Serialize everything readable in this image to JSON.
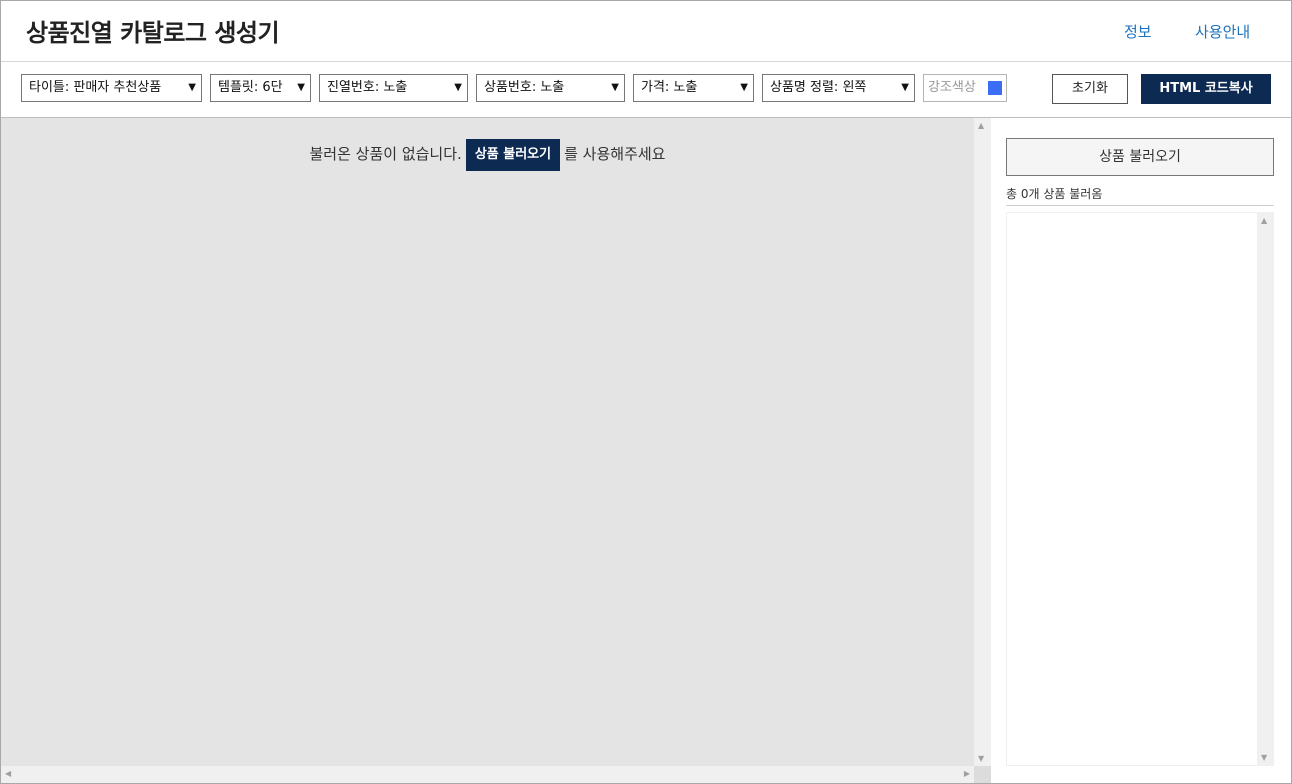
{
  "header": {
    "title": "상품진열 카탈로그 생성기",
    "nav": {
      "info": "정보",
      "guide": "사용안내"
    }
  },
  "toolbar": {
    "selects": {
      "title": "타이틀: 판매자 추천상품",
      "template": "템플릿: 6단",
      "display_number": "진열번호: 노출",
      "product_number": "상품번호: 노출",
      "price": "가격: 노출",
      "name_align": "상품명 정렬: 왼쪽"
    },
    "accent_color_label": "강조색상",
    "accent_color": "#3b6ef5",
    "reset_label": "초기화",
    "copy_label": "HTML 코드복사"
  },
  "preview": {
    "empty_prefix": "불러온 상품이 없습니다.",
    "load_button": "상품 불러오기",
    "empty_suffix": "를 사용해주세요"
  },
  "side": {
    "load_button": "상품 불러오기",
    "count_text": "총 0개 상품 불러옴"
  },
  "icons": {
    "dropdown": "triangle-down",
    "scroll_up": "triangle-up",
    "scroll_down": "triangle-down",
    "scroll_left": "triangle-left",
    "scroll_right": "triangle-right"
  }
}
